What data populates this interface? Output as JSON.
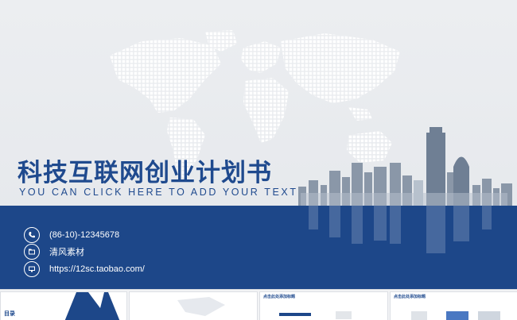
{
  "slide": {
    "title": "科技互联网创业计划书",
    "subtitle": "YOU CAN CLICK HERE TO ADD YOUR TEXT",
    "contacts": [
      {
        "icon": "phone-icon",
        "text": "(86-10)-12345678"
      },
      {
        "icon": "folder-icon",
        "text": "清风素材"
      },
      {
        "icon": "monitor-icon",
        "text": "https://12sc.taobao.com/"
      }
    ]
  },
  "thumbnails": [
    {
      "label": "目录"
    },
    {
      "label": ""
    },
    {
      "label": "点击此处添加标题"
    },
    {
      "label": "点击此处添加标题"
    }
  ],
  "colors": {
    "brand_blue": "#1f4a8e",
    "band_blue": "#1d4789",
    "background": "#e9ebee"
  }
}
